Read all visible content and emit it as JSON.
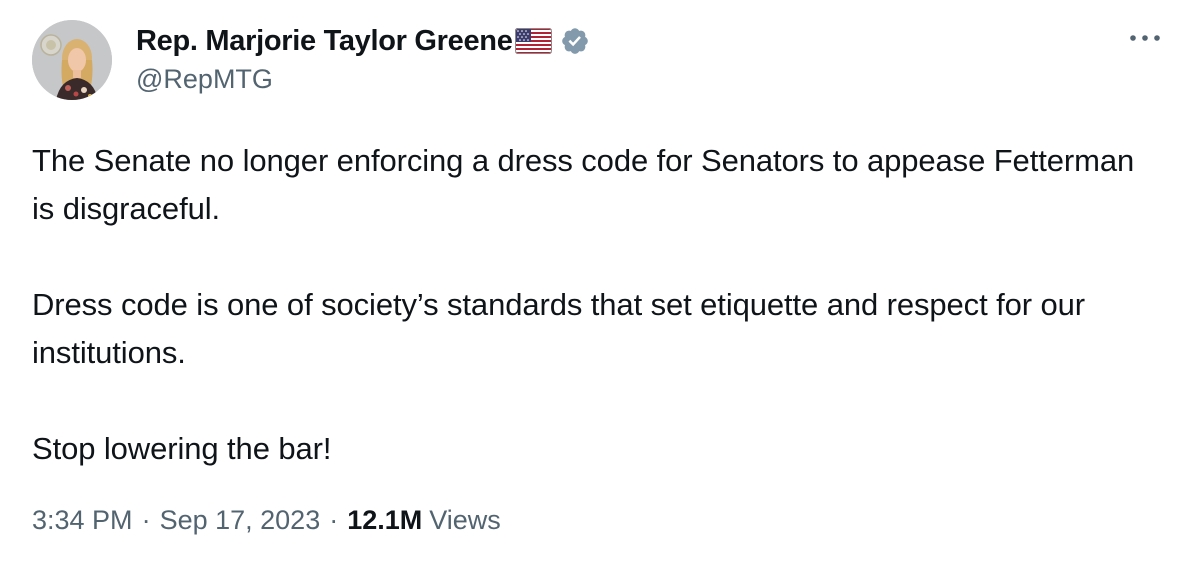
{
  "author": {
    "display_name": "Rep. Marjorie Taylor Greene",
    "handle": "@RepMTG",
    "flag_icon": "us-flag-icon",
    "verified_icon": "verified-badge-icon",
    "verified_color": "#829aab"
  },
  "tweet": {
    "paragraphs": [
      "The Senate no longer enforcing a dress code for Senators to appease Fetterman is disgraceful.",
      "Dress code is one of society’s standards that set etiquette and respect for our institutions.",
      "Stop lowering the bar!"
    ],
    "time": "3:34 PM",
    "date": "Sep 17, 2023",
    "separator": "·",
    "views_count": "12.1M",
    "views_label": "Views"
  },
  "menu": {
    "icon": "more-options-icon"
  },
  "colors": {
    "text": "#0f1419",
    "secondary": "#536471",
    "background": "#ffffff"
  }
}
